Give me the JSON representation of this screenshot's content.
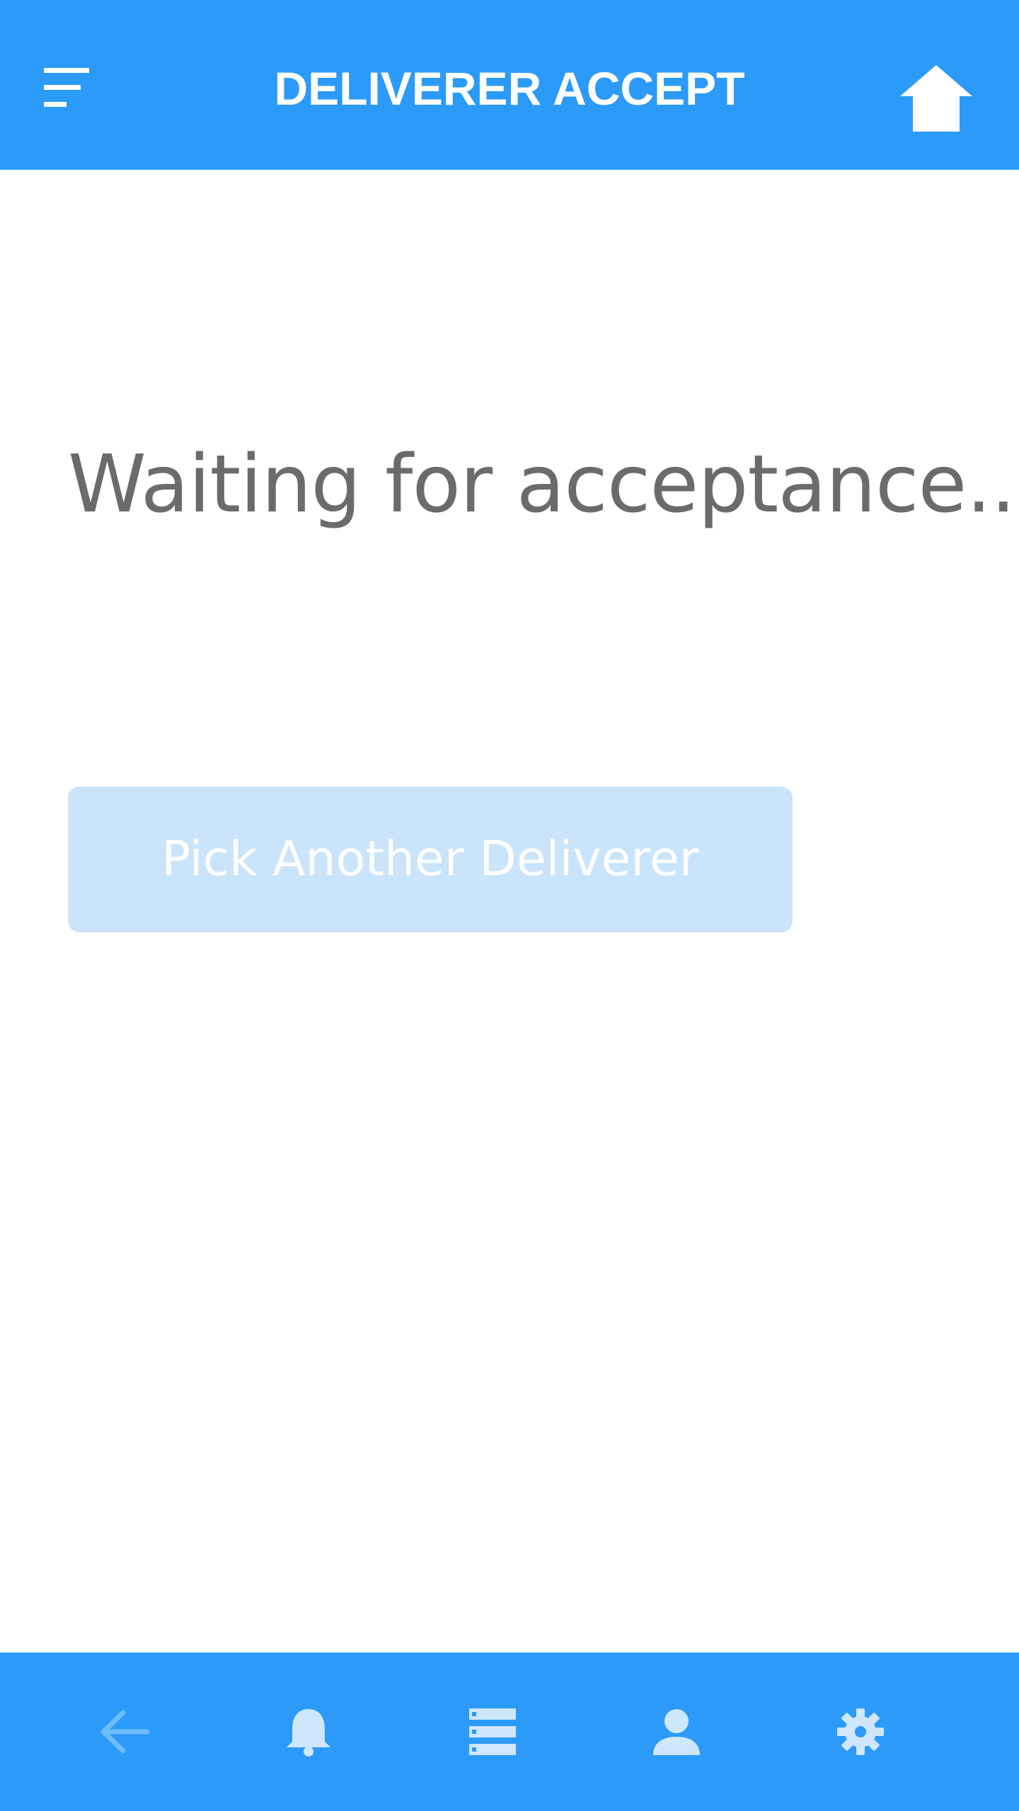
{
  "header": {
    "title": "DELIVERER ACCEPT",
    "menu_icon": "menu-icon",
    "home_icon": "home-icon"
  },
  "main": {
    "status_text": "Waiting for acceptance...",
    "pick_button_label": "Pick Another Deliverer"
  },
  "bottom_nav": {
    "items": [
      {
        "icon": "back-arrow-icon",
        "state": "disabled"
      },
      {
        "icon": "bell-icon",
        "state": "enabled"
      },
      {
        "icon": "list-icon",
        "state": "enabled"
      },
      {
        "icon": "user-icon",
        "state": "enabled"
      },
      {
        "icon": "gear-icon",
        "state": "enabled"
      }
    ]
  },
  "colors": {
    "primary": "#2b9af9",
    "button_disabled_bg": "#c9e4fb",
    "status_text": "#6b6b6b",
    "icon_light": "#cfe7fd",
    "icon_faded": "#6fbcfb"
  }
}
